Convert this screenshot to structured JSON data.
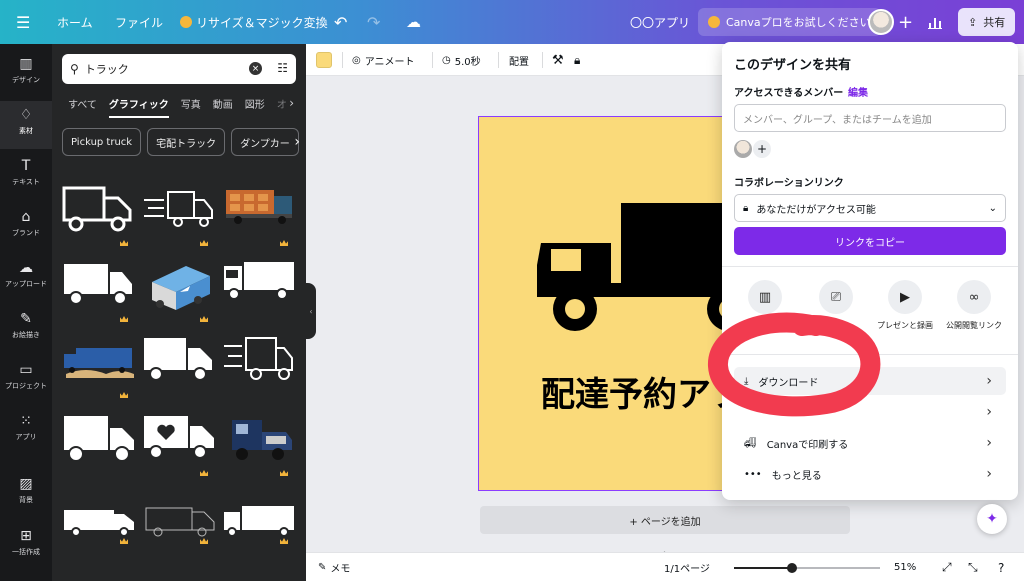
{
  "topbar": {
    "home": "ホーム",
    "file": "ファイル",
    "magic": "リサイズ＆マジック変換",
    "apps": "〇〇アプリ",
    "trial": "Canvaプロをお試しください",
    "share": "共有"
  },
  "rail": [
    {
      "label": "デザイン",
      "icon": "design-icon"
    },
    {
      "label": "素材",
      "icon": "elements-icon"
    },
    {
      "label": "テキスト",
      "icon": "text-icon"
    },
    {
      "label": "ブランド",
      "icon": "brand-icon"
    },
    {
      "label": "アップロード",
      "icon": "upload-icon"
    },
    {
      "label": "お絵描き",
      "icon": "draw-icon"
    },
    {
      "label": "プロジェクト",
      "icon": "folder-icon"
    },
    {
      "label": "アプリ",
      "icon": "apps-grid-icon"
    },
    {
      "label": "背景",
      "icon": "background-icon"
    },
    {
      "label": "一括作成",
      "icon": "bulk-create-icon"
    }
  ],
  "panel": {
    "search_value": "トラック",
    "tabs": [
      "すべて",
      "グラフィック",
      "写真",
      "動画",
      "図形",
      "オ"
    ],
    "chips": [
      "Pickup truck",
      "宅配トラック",
      "ダンプカー"
    ]
  },
  "toolbar": {
    "animate": "アニメート",
    "duration": "5.0秒",
    "arrange": "配置"
  },
  "canvas": {
    "title": "配達予約アプリ",
    "add_page": "+ ページを追加",
    "bg_color": "#fada7a"
  },
  "bottombar": {
    "memo": "メモ",
    "pages": "1/1ページ",
    "zoom": "51%",
    "zoom_fraction": 0.4
  },
  "share_panel": {
    "title": "このデザインを共有",
    "members_label": "アクセスできるメンバー",
    "edit": "編集",
    "input_placeholder": "メンバー、グループ、またはチームを追加",
    "collab_label": "コラボレーションリンク",
    "access_value": "あなただけがアクセス可能",
    "copy_link": "リンクをコピー",
    "options": [
      {
        "label": "",
        "icon": "template-icon"
      },
      {
        "label": "ーシ",
        "icon": "presentation-icon"
      },
      {
        "label": "プレゼンと録画",
        "icon": "video-record-icon"
      },
      {
        "label": "公開閲覧リンク",
        "icon": "link-icon"
      }
    ],
    "rows": [
      {
        "label": "ダウンロード",
        "icon": "download-icon"
      },
      {
        "label": "",
        "icon": ""
      },
      {
        "label": "Canvaで印刷する",
        "icon": "print-truck-icon"
      },
      {
        "label": "もっと見る",
        "icon": "more-dots-icon"
      }
    ]
  },
  "colors": {
    "accent": "#7d2ae8",
    "scribble": "#f23b4f"
  }
}
